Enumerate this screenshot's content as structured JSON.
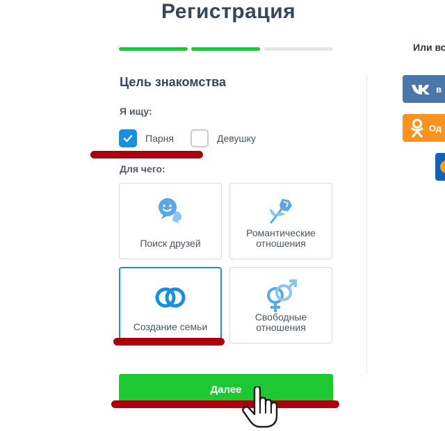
{
  "page": {
    "title": "Регистрация"
  },
  "progress": {
    "steps_total": 3,
    "steps_done": 2
  },
  "form": {
    "section_title": "Цель знакомства",
    "looking_for_label": "Я ищу:",
    "options": [
      {
        "label": "Парня",
        "checked": true
      },
      {
        "label": "Девушку",
        "checked": false
      }
    ],
    "purpose_label": "Для чего:",
    "cards": [
      {
        "label": "Поиск друзей",
        "icon": "chat-bubbles-icon",
        "selected": false
      },
      {
        "label": "Романтические\nотношения",
        "icon": "flower-icon",
        "selected": false
      },
      {
        "label": "Создание семьи",
        "icon": "rings-icon",
        "selected": true
      },
      {
        "label": "Свободные\nотношения",
        "icon": "gender-symbols-icon",
        "selected": false
      }
    ],
    "submit_label": "Далее"
  },
  "social": {
    "label": "Или вс",
    "vk_label": "в",
    "ok_label": "Од"
  },
  "colors": {
    "accent": "#1a8fe0",
    "submit": "#1ec832",
    "progress_done": "#1fc63a",
    "annotation": "#a8000f"
  }
}
